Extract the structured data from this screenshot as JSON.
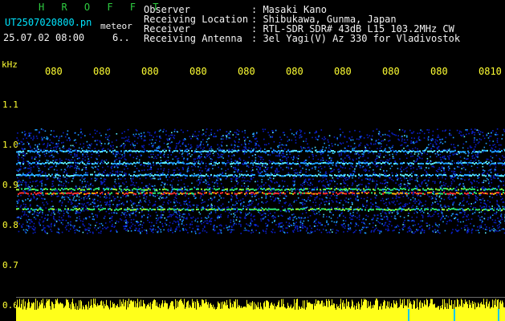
{
  "header": {
    "brand": "H R O F F T",
    "filename": "UT2507020800.pn",
    "meteor_label": "meteor",
    "datetime": "25.07.02 08:00",
    "count": "6..",
    "meta": [
      {
        "key": "Observer",
        "value": ": Masaki Kano"
      },
      {
        "key": "Receiving Location",
        "value": ": Shibukawa, Gunma, Japan"
      },
      {
        "key": "Receiver",
        "value": ": RTL-SDR SDR# 43dB L15 103.2MHz CW"
      },
      {
        "key": "Receiving Antenna",
        "value": ": 3el Yagi(V) Az 330 for Vladivostok"
      }
    ]
  },
  "axes": {
    "y_unit": "kHz",
    "x_ticks": [
      "080",
      "080",
      "080",
      "080",
      "080",
      "080",
      "080",
      "080",
      "080",
      "0810"
    ],
    "y_ticks": [
      "1.1",
      "1.0",
      "0.9",
      "0.8",
      "0.7",
      "0.6"
    ]
  },
  "colors": {
    "background": "#000000",
    "text_header": "#f2f2f2",
    "text_brand": "#2ecc40",
    "text_file": "#00e5ff",
    "axis_text": "#ffff33",
    "noise_low": "#0a1ec8",
    "noise_mid": "#1ea0ff",
    "signal_green": "#2ee86b",
    "signal_red": "#ff2d2d",
    "bar_yellow": "#ffff1a"
  },
  "spectrogram": {
    "noise_band_khz": [
      0.76,
      1.02
    ],
    "carrier_lines_khz": [
      0.965,
      0.935,
      0.905,
      0.87,
      0.86,
      0.82
    ]
  }
}
